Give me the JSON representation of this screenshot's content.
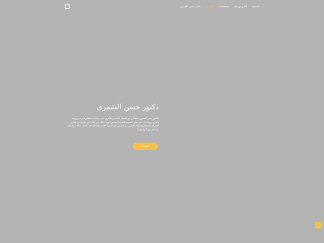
{
  "nav": {
    "items": [
      {
        "label": "دكتور حسن الشمري",
        "active": false
      },
      {
        "label": "الرئيسية",
        "active": true
      },
      {
        "label": "استشارات",
        "active": false
      },
      {
        "label": "احجز موعدك",
        "active": false
      },
      {
        "label": "المدونة",
        "active": false
      }
    ]
  },
  "hero": {
    "title": "دكتور حسن الشمري",
    "body": "الدكتور حسن الشمري استشاري في المجال النفسي والأسري، يقدم جلسات استشارية فردية وزوجية وأسرية، ويساعدك على تجاوز الضغوط النفسية وتحسين جودة حياتك، من خلال خبرة طويلة في العلاج المعرفي السلوكي والإرشاد الأسري، مع الحرص على السرية التامة والاهتمام بكل تفاصيل حالتك لتصل إلى حياة أكثر توازناً واستقراراً.",
    "cta_label": "احجز الآن"
  },
  "colors": {
    "accent": "#f6c04a",
    "background": "#b4b4b4",
    "text": "#ffffff"
  },
  "icons": {
    "logo": "logo-icon",
    "chat": "chat-icon"
  }
}
